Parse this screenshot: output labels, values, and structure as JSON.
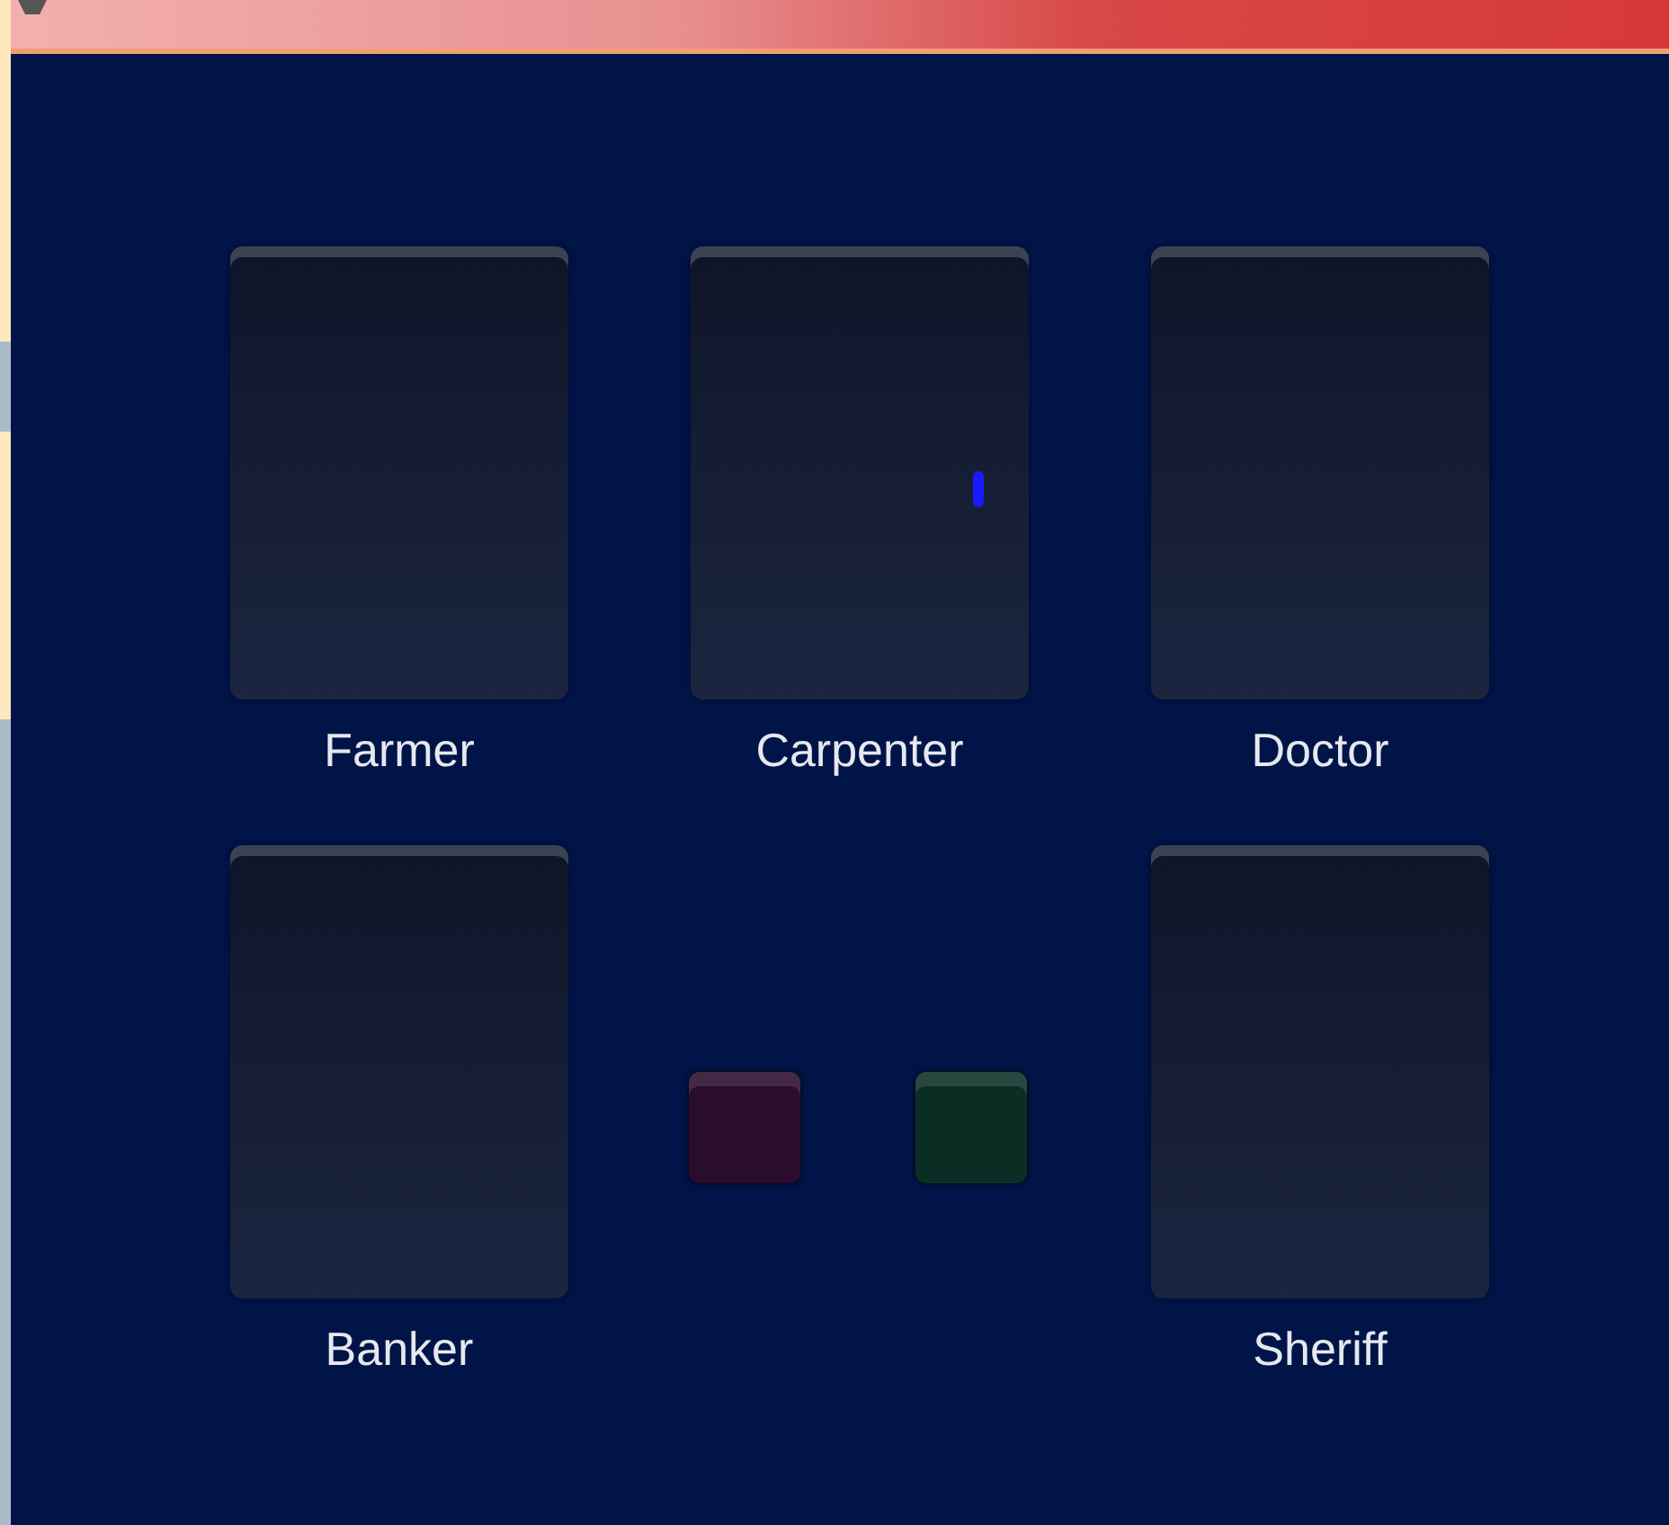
{
  "slots": [
    {
      "kind": "role",
      "label": "Farmer"
    },
    {
      "kind": "role",
      "label": "Carpenter"
    },
    {
      "kind": "role",
      "label": "Doctor"
    },
    {
      "kind": "role",
      "label": "Banker"
    },
    {
      "kind": "buttons"
    },
    {
      "kind": "role",
      "label": "Sheriff"
    }
  ],
  "color_buttons": [
    {
      "color": "#2a0c2c"
    },
    {
      "color": "#0b2e24"
    }
  ]
}
